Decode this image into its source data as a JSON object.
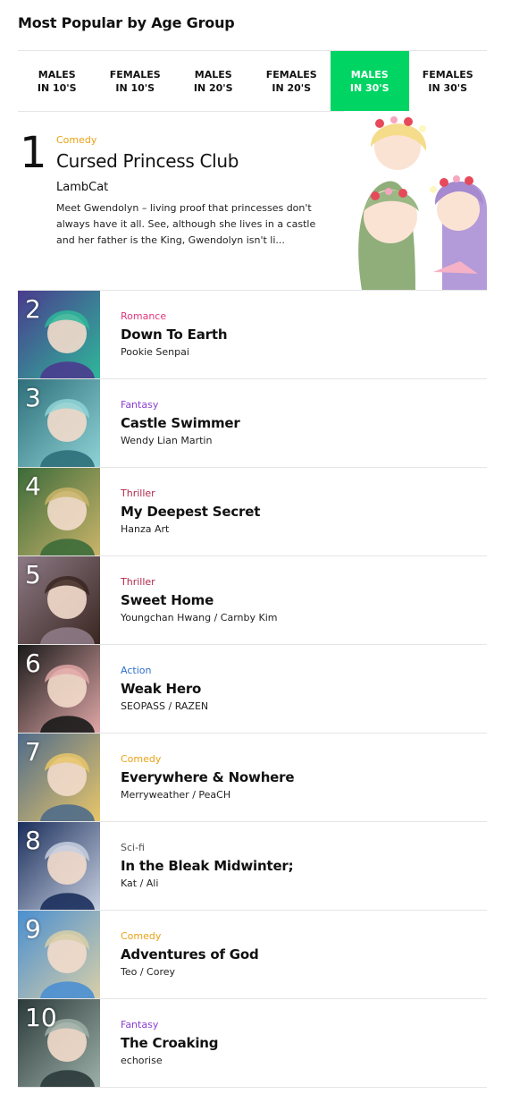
{
  "section_title": "Most Popular by Age Group",
  "tabs": [
    {
      "label": "MALES\nIN 10'S",
      "active": false
    },
    {
      "label": "FEMALES\nIN 10'S",
      "active": false
    },
    {
      "label": "MALES\nIN 20'S",
      "active": false
    },
    {
      "label": "FEMALES\nIN 20'S",
      "active": false
    },
    {
      "label": "MALES\nIN 30'S",
      "active": true
    },
    {
      "label": "FEMALES\nIN 30'S",
      "active": false
    }
  ],
  "featured": {
    "rank": "1",
    "genre": "Comedy",
    "genre_color": "#e8a317",
    "title": "Cursed Princess Club",
    "author": "LambCat",
    "description": "Meet Gwendolyn – living proof that princesses don't always have it all. See, although she lives in a castle and her father is the King, Gwendolyn isn't li..."
  },
  "items": [
    {
      "rank": "2",
      "genre": "Romance",
      "genre_color": "#e0357a",
      "title": "Down To Earth",
      "author": "Pookie Senpai",
      "c1": "#4a3b8e",
      "c2": "#2fb79a"
    },
    {
      "rank": "3",
      "genre": "Fantasy",
      "genre_color": "#8a3fd1",
      "title": "Castle Swimmer",
      "author": "Wendy Lian Martin",
      "c1": "#2e6f7a",
      "c2": "#8fd3d6"
    },
    {
      "rank": "4",
      "genre": "Thriller",
      "genre_color": "#b0264a",
      "title": "My Deepest Secret",
      "author": "Hanza Art",
      "c1": "#3c6b3a",
      "c2": "#c9b46a"
    },
    {
      "rank": "5",
      "genre": "Thriller",
      "genre_color": "#b0264a",
      "title": "Sweet Home",
      "author": "Youngchan Hwang / Carnby Kim",
      "c1": "#8d7a86",
      "c2": "#3a2620"
    },
    {
      "rank": "6",
      "genre": "Action",
      "genre_color": "#2f6fc9",
      "title": "Weak Hero",
      "author": "SEOPASS / RAZEN",
      "c1": "#1a1a1a",
      "c2": "#e0a7a7"
    },
    {
      "rank": "7",
      "genre": "Comedy",
      "genre_color": "#e8a317",
      "title": "Everywhere & Nowhere",
      "author": "Merryweather / PeaCH",
      "c1": "#4f6b8a",
      "c2": "#e8c66a"
    },
    {
      "rank": "8",
      "genre": "Sci-fi",
      "genre_color": "#555555",
      "title": "In the Bleak Midwinter;",
      "author": "Kat / Ali",
      "c1": "#1b2f5c",
      "c2": "#c7cfe0"
    },
    {
      "rank": "9",
      "genre": "Comedy",
      "genre_color": "#e8a317",
      "title": "Adventures of God",
      "author": "Teo / Corey",
      "c1": "#4a8fd1",
      "c2": "#d8cfa8"
    },
    {
      "rank": "10",
      "genre": "Fantasy",
      "genre_color": "#8a3fd1",
      "title": "The Croaking",
      "author": "echorise",
      "c1": "#2b3a3a",
      "c2": "#9db0a8"
    }
  ]
}
